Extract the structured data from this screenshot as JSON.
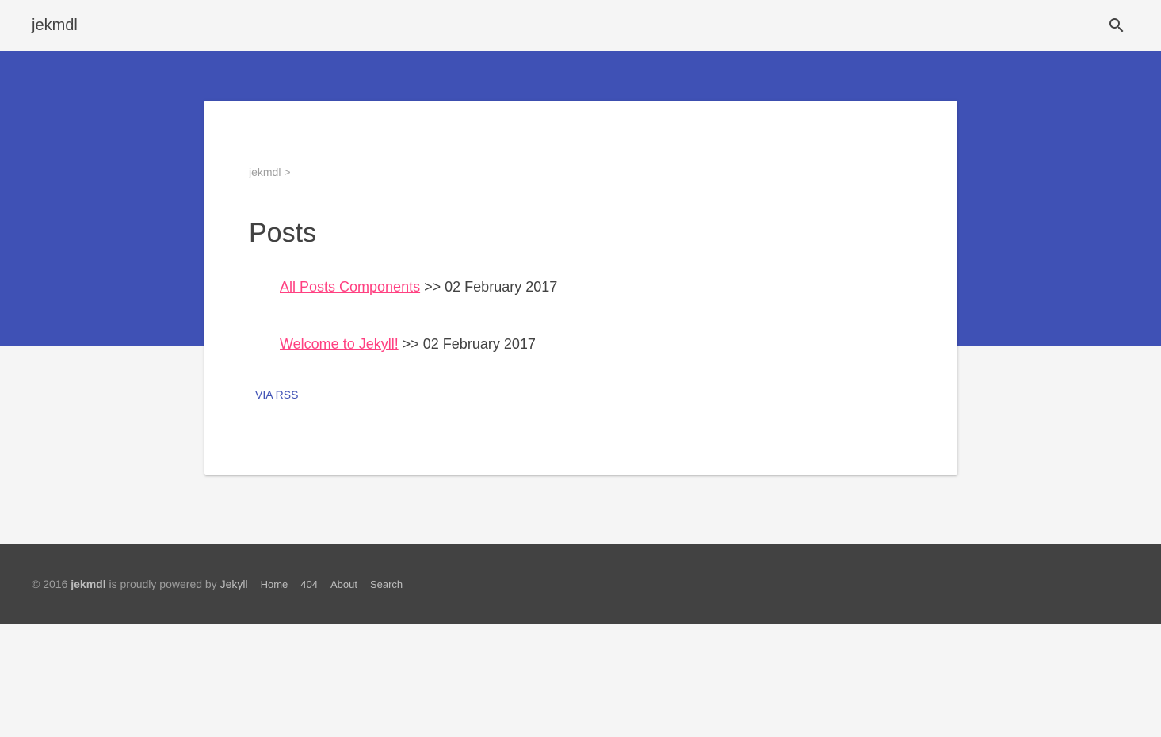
{
  "header": {
    "site_title": "jekmdl",
    "search_icon": "search-icon"
  },
  "colors": {
    "primary": "#3f51b5",
    "accent": "#ff4081",
    "footer_bg": "#424242",
    "page_bg": "#f5f5f5"
  },
  "main": {
    "breadcrumb": {
      "home": "jekmdl",
      "separator": ">"
    },
    "title": "Posts",
    "posts": [
      {
        "title": "All Posts Components",
        "separator": ">>",
        "date": "02 February 2017"
      },
      {
        "title": "Welcome to Jekyll!",
        "separator": ">>",
        "date": "02 February 2017"
      }
    ],
    "rss_label": "VIA RSS"
  },
  "footer": {
    "copyright_prefix": "© 2016",
    "site_name": "jekmdl",
    "powered_text": "is proudly powered by",
    "jekyll": "Jekyll",
    "links": [
      "Home",
      "404",
      "About",
      "Search"
    ]
  }
}
